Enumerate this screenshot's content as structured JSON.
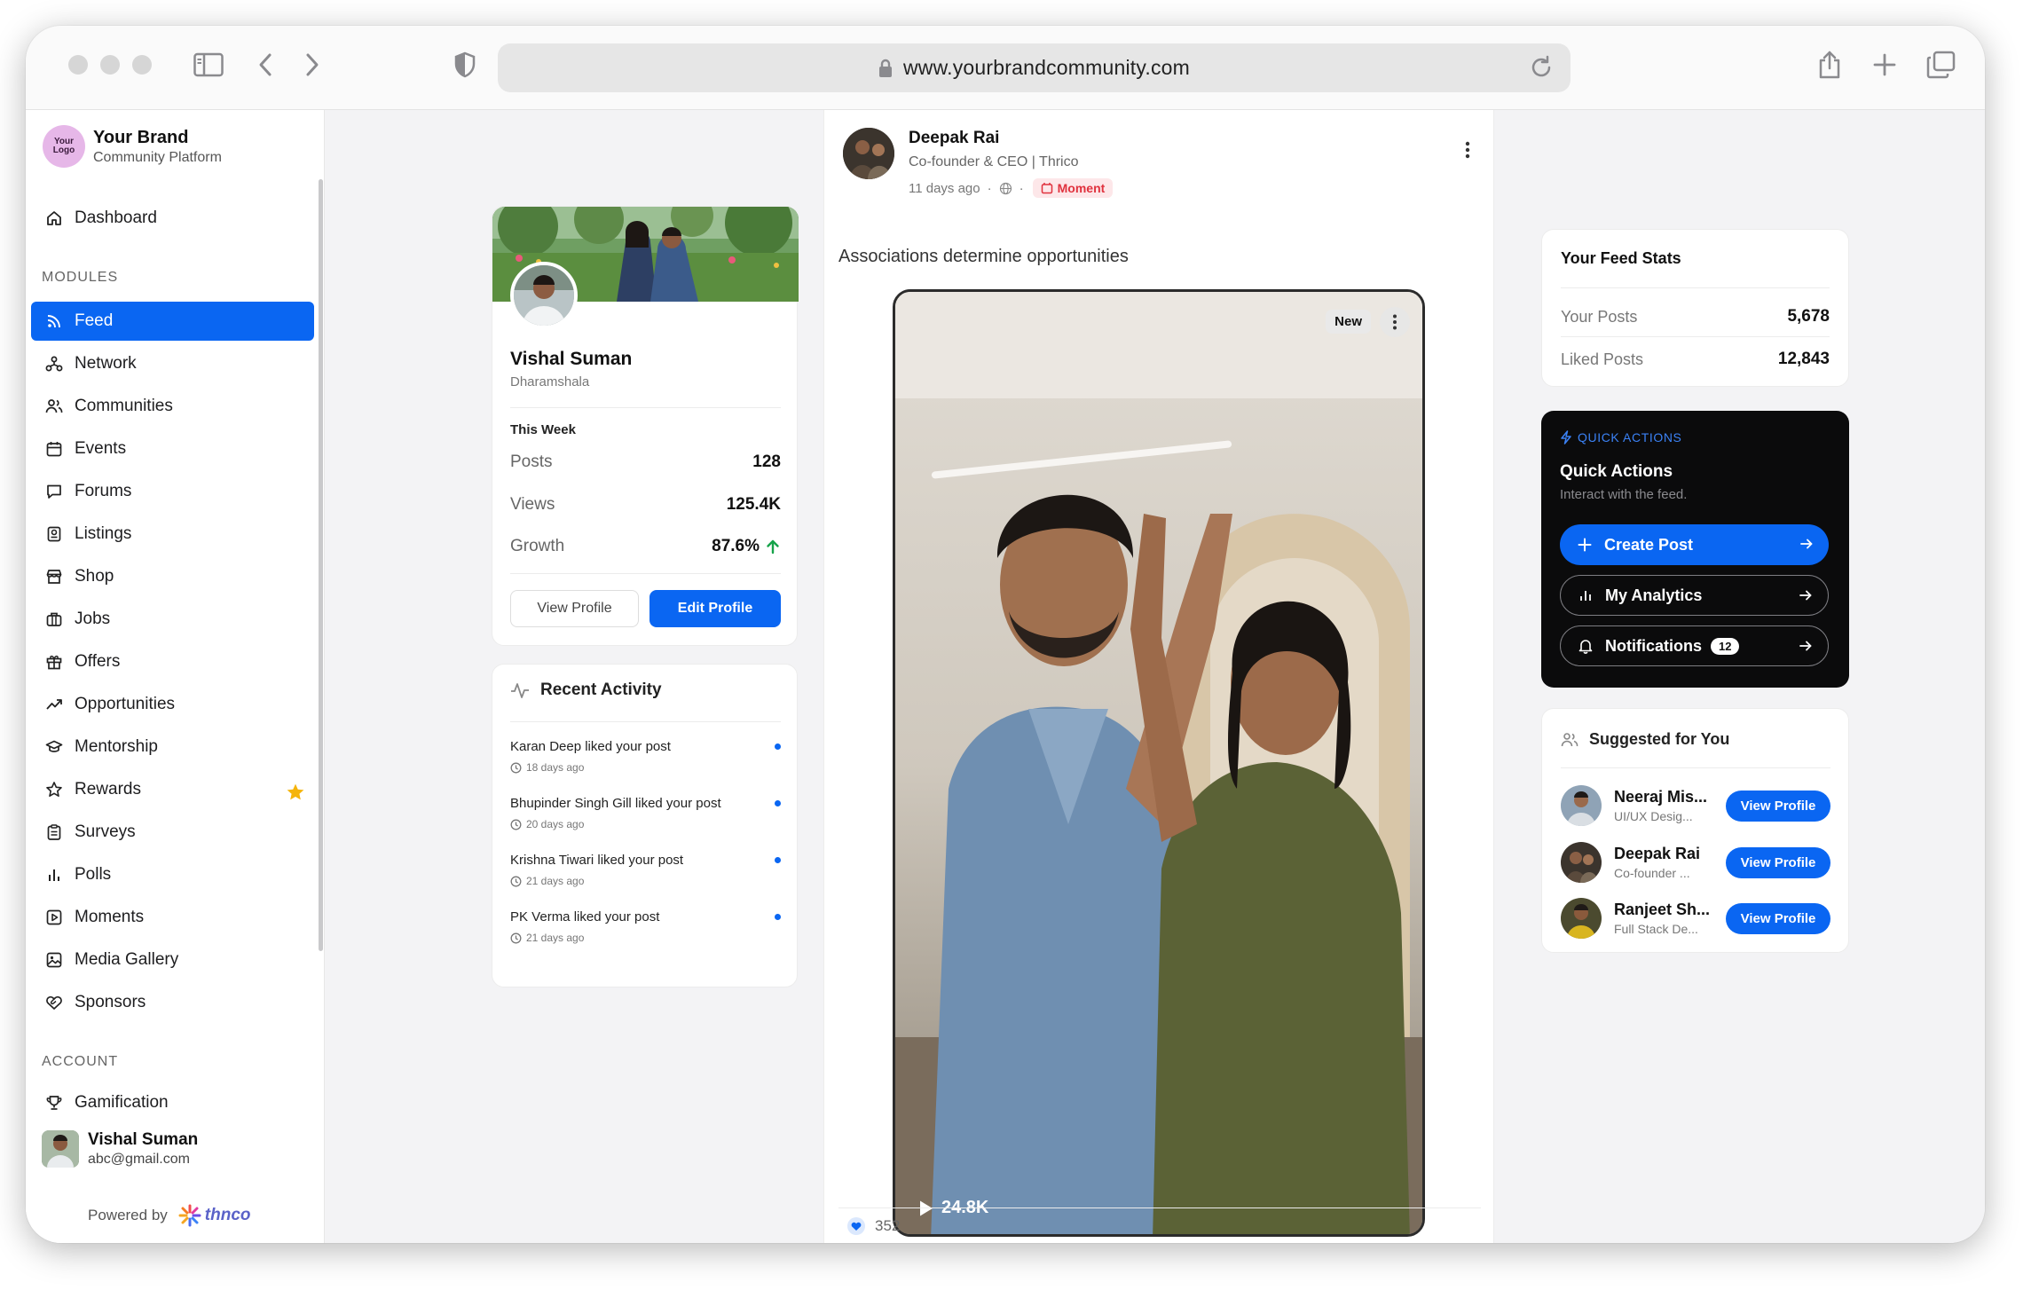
{
  "browser": {
    "url": "www.yourbrandcommunity.com"
  },
  "sidebar": {
    "logo_text": "Your Logo",
    "brand_name": "Your Brand",
    "brand_sub": "Community Platform",
    "dashboard": "Dashboard",
    "modules_heading": "MODULES",
    "items": [
      {
        "label": "Feed",
        "icon": "rss-icon"
      },
      {
        "label": "Network",
        "icon": "network-icon"
      },
      {
        "label": "Communities",
        "icon": "users-icon"
      },
      {
        "label": "Events",
        "icon": "calendar-icon"
      },
      {
        "label": "Forums",
        "icon": "chat-icon"
      },
      {
        "label": "Listings",
        "icon": "listing-icon"
      },
      {
        "label": "Shop",
        "icon": "store-icon"
      },
      {
        "label": "Jobs",
        "icon": "briefcase-icon"
      },
      {
        "label": "Offers",
        "icon": "gift-icon"
      },
      {
        "label": "Opportunities",
        "icon": "trend-icon"
      },
      {
        "label": "Mentorship",
        "icon": "graduation-icon"
      },
      {
        "label": "Rewards",
        "icon": "star-outline-icon"
      },
      {
        "label": "Surveys",
        "icon": "clipboard-icon"
      },
      {
        "label": "Polls",
        "icon": "bar-chart-icon"
      },
      {
        "label": "Moments",
        "icon": "play-square-icon"
      },
      {
        "label": "Media Gallery",
        "icon": "image-icon"
      },
      {
        "label": "Sponsors",
        "icon": "handshake-icon"
      }
    ],
    "account_heading": "ACCOUNT",
    "gamification": "Gamification",
    "user_name": "Vishal Suman",
    "user_email": "abc@gmail.com",
    "powered_by": "Powered by",
    "powered_brand": "thnco"
  },
  "profile_card": {
    "name": "Vishal Suman",
    "location": "Dharamshala",
    "week_heading": "This Week",
    "stats": [
      {
        "label": "Posts",
        "value": "128"
      },
      {
        "label": "Views",
        "value": "125.4K"
      },
      {
        "label": "Growth",
        "value": "87.6%"
      }
    ],
    "view_profile": "View Profile",
    "edit_profile": "Edit Profile"
  },
  "recent_activity": {
    "title": "Recent Activity",
    "items": [
      {
        "text": "Karan Deep liked your post",
        "time": "18 days ago"
      },
      {
        "text": "Bhupinder Singh Gill liked your post",
        "time": "20 days ago"
      },
      {
        "text": "Krishna Tiwari liked your post",
        "time": "21 days ago"
      },
      {
        "text": "PK Verma liked your post",
        "time": "21 days ago"
      }
    ]
  },
  "post": {
    "author": "Deepak Rai",
    "role": "Co-founder & CEO | Thrico",
    "time": "11 days ago",
    "badge": "Moment",
    "text": "Associations determine opportunities",
    "video_badge": "New",
    "views": "24.8K",
    "likes": "352"
  },
  "feed_stats": {
    "title": "Your Feed Stats",
    "rows": [
      {
        "label": "Your Posts",
        "value": "5,678"
      },
      {
        "label": "Liked Posts",
        "value": "12,843"
      }
    ]
  },
  "quick_actions": {
    "tag": "QUICK ACTIONS",
    "title": "Quick Actions",
    "subtitle": "Interact with the feed.",
    "create_post": "Create Post",
    "my_analytics": "My Analytics",
    "notifications": "Notifications",
    "notifications_count": "12"
  },
  "suggested": {
    "title": "Suggested for You",
    "people": [
      {
        "name": "Neeraj Mis...",
        "role": "UI/UX Desig...",
        "button": "View Profile"
      },
      {
        "name": "Deepak Rai",
        "role": "Co-founder ...",
        "button": "View Profile"
      },
      {
        "name": "Ranjeet Sh...",
        "role": "Full Stack De...",
        "button": "View Profile"
      }
    ]
  },
  "colors": {
    "accent": "#0a66f2",
    "moment": "#e0323e",
    "growth": "#16a34a",
    "star": "#f5b40a"
  }
}
